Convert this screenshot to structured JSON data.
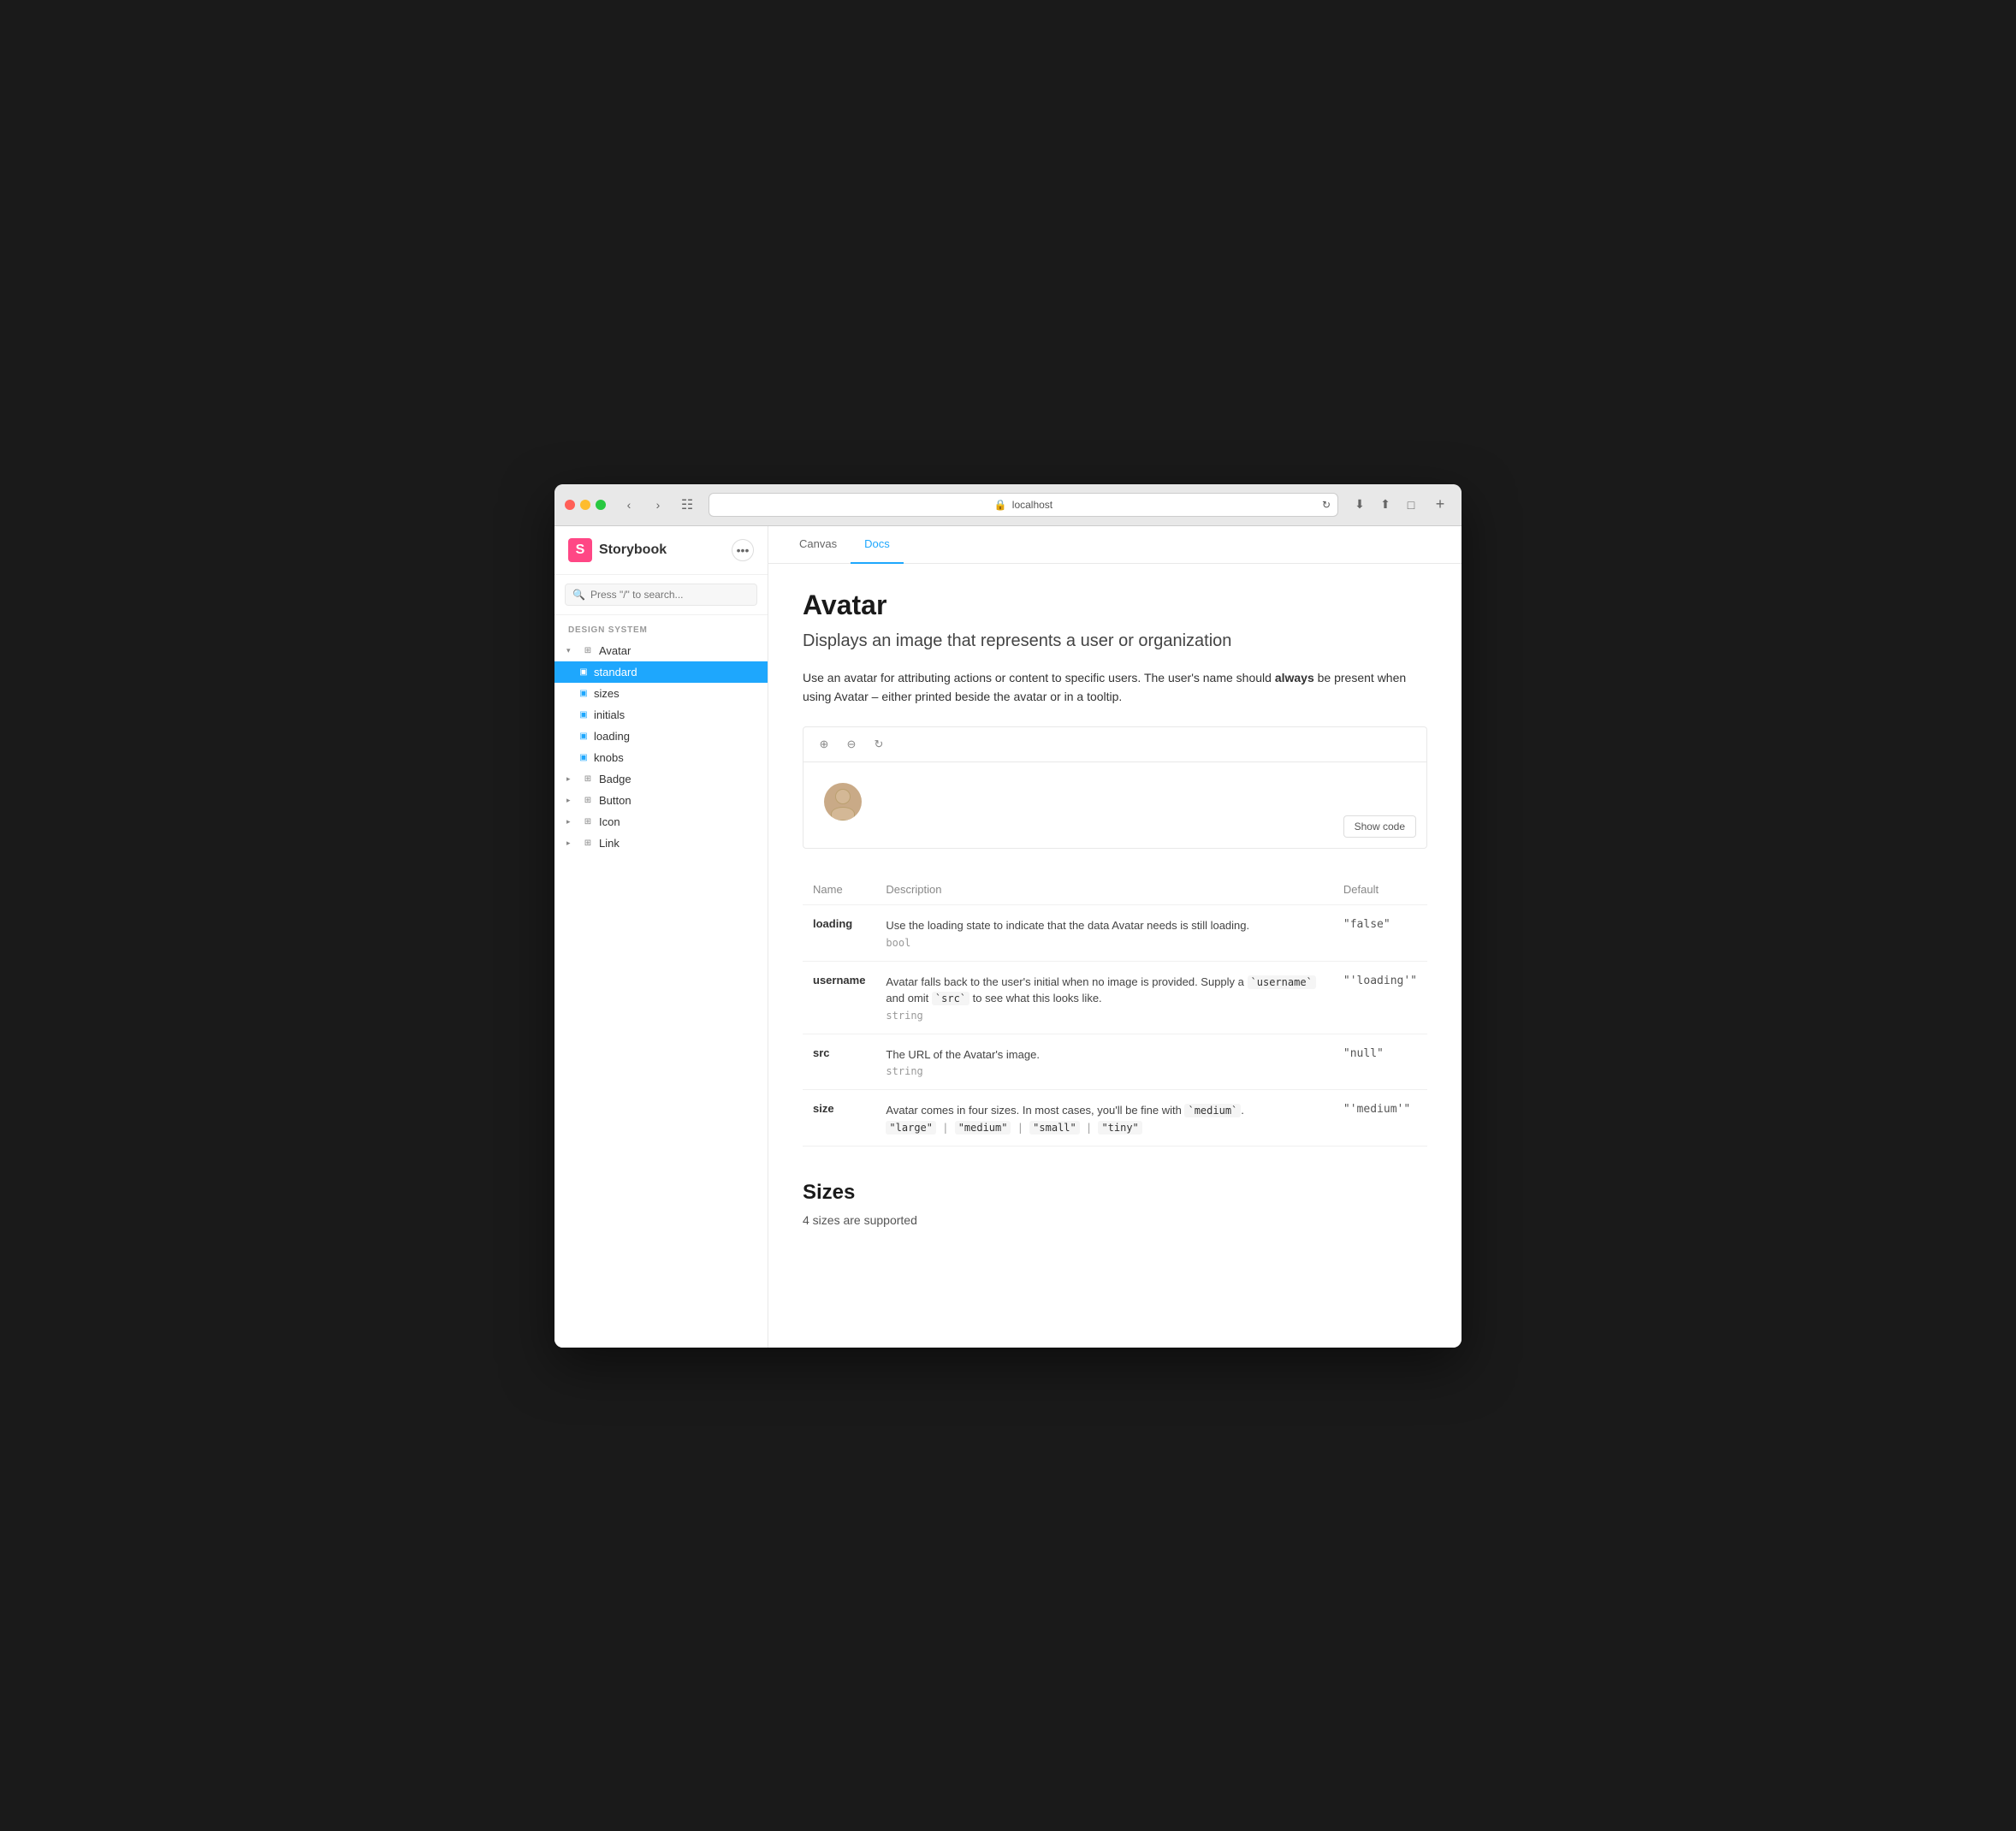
{
  "browser": {
    "url": "localhost",
    "tabs": [
      "Canvas",
      "Docs"
    ],
    "active_tab": "Docs"
  },
  "sidebar": {
    "logo": "S",
    "app_name": "Storybook",
    "search_placeholder": "Press \"/\" to search...",
    "section_label": "DESIGN SYSTEM",
    "items": [
      {
        "id": "avatar",
        "label": "Avatar",
        "level": 0,
        "type": "group",
        "expanded": true
      },
      {
        "id": "avatar-standard",
        "label": "standard",
        "level": 1,
        "type": "story",
        "active": true
      },
      {
        "id": "avatar-sizes",
        "label": "sizes",
        "level": 1,
        "type": "story"
      },
      {
        "id": "avatar-initials",
        "label": "initials",
        "level": 1,
        "type": "story"
      },
      {
        "id": "avatar-loading",
        "label": "loading",
        "level": 1,
        "type": "story"
      },
      {
        "id": "avatar-knobs",
        "label": "knobs",
        "level": 1,
        "type": "story"
      },
      {
        "id": "badge",
        "label": "Badge",
        "level": 0,
        "type": "group"
      },
      {
        "id": "button",
        "label": "Button",
        "level": 0,
        "type": "group"
      },
      {
        "id": "icon",
        "label": "Icon",
        "level": 0,
        "type": "group"
      },
      {
        "id": "link",
        "label": "Link",
        "level": 0,
        "type": "group"
      }
    ]
  },
  "docs": {
    "component_title": "Avatar",
    "component_subtitle": "Displays an image that represents a user or organization",
    "description_1": "Use an avatar for attributing actions or content to specific users. The user's name should ",
    "description_bold": "always",
    "description_2": " be present when using Avatar – either printed beside the avatar or in a tooltip.",
    "show_code_label": "Show code",
    "props_table": {
      "col_name": "Name",
      "col_description": "Description",
      "col_default": "Default",
      "rows": [
        {
          "name": "loading",
          "description": "Use the loading state to indicate that the data Avatar needs is still loading.",
          "type": "bool",
          "default": "\"false\""
        },
        {
          "name": "username",
          "description": "Avatar falls back to the user’s initial when no image is provided. Supply a `username` and omit `src` to see what this looks like.",
          "type": "string",
          "default": "\"'loading'\""
        },
        {
          "name": "src",
          "description": "The URL of the Avatar's image.",
          "type": "string",
          "default": "\"null\""
        },
        {
          "name": "size",
          "description": "Avatar comes in four sizes. In most cases, you'll be fine with `medium`.",
          "type_options": "\"large\" | \"medium\" | \"small\" | \"tiny\"",
          "default": "\"'medium'\""
        }
      ]
    },
    "sizes_section": {
      "title": "Sizes",
      "subtitle": "4 sizes are supported"
    }
  }
}
